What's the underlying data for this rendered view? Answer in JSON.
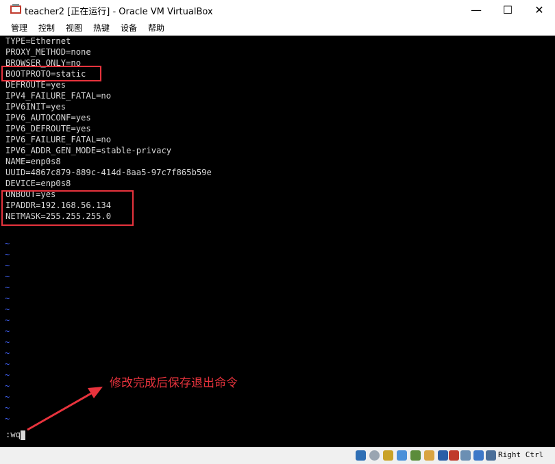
{
  "window": {
    "title": "teacher2 [正在运行] - Oracle VM VirtualBox",
    "icon": "virtualbox-icon",
    "controls": {
      "minimize": "—",
      "maximize": "☐",
      "close": "✕"
    }
  },
  "menu": [
    "管理",
    "控制",
    "视图",
    "热键",
    "设备",
    "帮助"
  ],
  "terminal": {
    "lines": [
      "TYPE=Ethernet",
      "PROXY_METHOD=none",
      "BROWSER_ONLY=no",
      "BOOTPROTO=static",
      "DEFROUTE=yes",
      "IPV4_FAILURE_FATAL=no",
      "IPV6INIT=yes",
      "IPV6_AUTOCONF=yes",
      "IPV6_DEFROUTE=yes",
      "IPV6_FAILURE_FATAL=no",
      "IPV6_ADDR_GEN_MODE=stable-privacy",
      "NAME=enp0s8",
      "UUID=4867c879-889c-414d-8aa5-97c7f865b59e",
      "DEVICE=enp0s8",
      "ONBOOT=yes",
      "IPADDR=192.168.56.134",
      "NETMASK=255.255.255.0"
    ],
    "empty_line_marker": "~",
    "command": ":wq"
  },
  "annotation": {
    "text": "修改完成后保存退出命令",
    "color": "#e8333d"
  },
  "statusbar": {
    "host_key": "Right Ctrl",
    "icons": [
      "hard-disk-icon",
      "optical-drive-icon",
      "audio-icon",
      "network-icon",
      "usb-icon",
      "shared-folder-icon",
      "display-icon",
      "video-capture-icon",
      "virtualization-icon",
      "mouse-integration-icon",
      "keyboard-icon"
    ]
  },
  "colors": {
    "terminal_bg": "#000000",
    "terminal_fg": "#d8d8d8",
    "tilde": "#4466ff",
    "highlight": "#e8333d"
  }
}
